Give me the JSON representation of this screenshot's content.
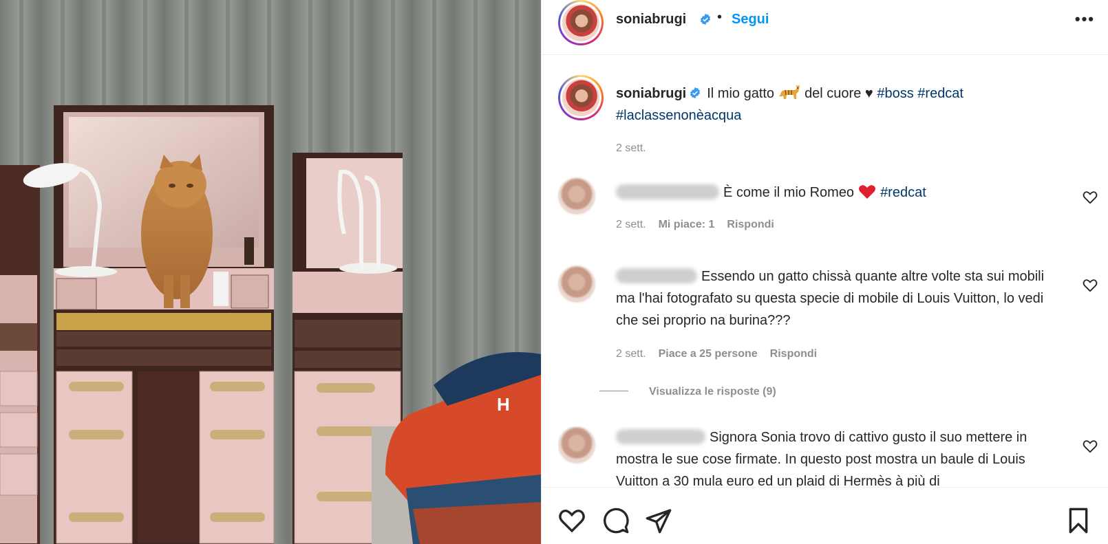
{
  "header": {
    "username": "soniabrugi",
    "separator": "•",
    "follow_label": "Segui",
    "more_label": "•••"
  },
  "caption": {
    "username": "soniabrugi",
    "text_before": "Il mio gatto",
    "text_after": "del cuore ♥",
    "hashtag_1": "#boss",
    "hashtag_2": "#redcat",
    "hashtag_3": "#laclassenonèacqua",
    "time": "2 sett."
  },
  "comments": [
    {
      "text": "È come il mio Romeo",
      "hashtag": "#redcat",
      "time": "2 sett.",
      "likes": "Mi piace: 1",
      "reply": "Rispondi"
    },
    {
      "text": "Essendo un gatto chissà quante altre volte sta sui mobili ma l'hai fotografato su questa specie di mobile di Louis Vuitton, lo vedi che sei proprio na burina???",
      "time": "2 sett.",
      "likes": "Piace a 25 persone",
      "reply": "Rispondi",
      "view_replies": "Visualizza le risposte (9)"
    },
    {
      "text": "Signora Sonia trovo di cattivo gusto il suo mettere in mostra le sue cose firmate. In questo post mostra un baule di Louis Vuitton a 30 mula euro ed un plaid di Hermès à più di"
    }
  ],
  "photo": {
    "blanket_letter": "H"
  },
  "colors": {
    "link": "#0095f6",
    "hashtag": "#00376b",
    "muted": "#8e8e8e",
    "verified": "#3897f0",
    "heart": "#ed4956"
  }
}
